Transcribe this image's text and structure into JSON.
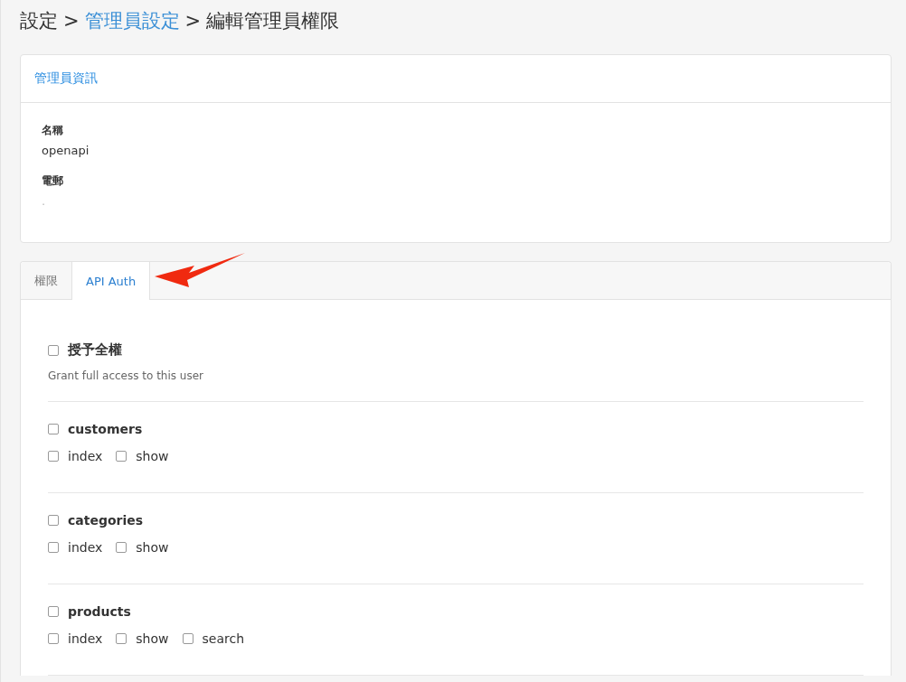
{
  "breadcrumb": [
    {
      "label": "設定",
      "link": false
    },
    {
      "label": "管理員設定",
      "link": true
    },
    {
      "label": "編輯管理員權限",
      "link": false
    }
  ],
  "breadcrumb_separator": ">",
  "info_card": {
    "title": "管理員資訊",
    "fields": [
      {
        "label": "名稱",
        "value": "openapi"
      },
      {
        "label": "電郵",
        "value": "."
      }
    ]
  },
  "tabs": [
    {
      "label": "權限",
      "selected": false
    },
    {
      "label": "API Auth",
      "selected": true
    }
  ],
  "grant_all": {
    "label": "授予全權",
    "checked": false,
    "help": "Grant full access to this user"
  },
  "resources": [
    {
      "name": "customers",
      "checked": false,
      "actions": [
        {
          "label": "index",
          "checked": false
        },
        {
          "label": "show",
          "checked": false
        }
      ]
    },
    {
      "name": "categories",
      "checked": false,
      "actions": [
        {
          "label": "index",
          "checked": false
        },
        {
          "label": "show",
          "checked": false
        }
      ]
    },
    {
      "name": "products",
      "checked": false,
      "actions": [
        {
          "label": "index",
          "checked": false
        },
        {
          "label": "show",
          "checked": false
        },
        {
          "label": "search",
          "checked": false
        }
      ]
    }
  ]
}
